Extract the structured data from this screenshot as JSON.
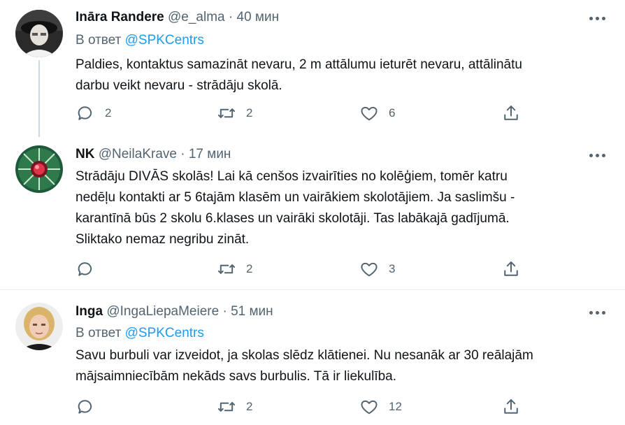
{
  "tweets": [
    {
      "name": "Ināra Randere",
      "handle": "@e_alma",
      "separator": "·",
      "time": "40 мин",
      "reply_prefix": "В ответ",
      "reply_mention": "@SPKCentrs",
      "text": "Paldies, kontaktus samazināt nevaru, 2 m attālumu ieturēt nevaru, attālinātu\ndarbu veikt nevaru - strādāju skolā.",
      "replies": "2",
      "retweets": "2",
      "likes": "6"
    },
    {
      "name": "NK",
      "handle": "@NeilaKrave",
      "separator": "·",
      "time": "17 мин",
      "text": "Strādāju DIVĀS skolās! Lai kā cenšos izvairīties no kolēģiem, tomēr katru\nnedēļu kontakti ar 5 6tajām klasēm un vairākiem skolotājiem. Ja saslimšu -\nkarantīnā būs 2 skolu 6.klases un vairāki skolotāji. Tas labākajā gadījumā.\nSliktako nemaz negribu zināt.",
      "replies": "",
      "retweets": "2",
      "likes": "3"
    },
    {
      "name": "Inga",
      "handle": "@IngaLiepaMeiere",
      "separator": "·",
      "time": "51 мин",
      "reply_prefix": "В ответ",
      "reply_mention": "@SPKCentrs",
      "text": "Savu burbuli var izveidot, ja skolas slēdz klātienei. Nu nesanāk ar 30 reālajām\nmājsaimniecībām nekāds savs burbulis. Tā ir liekulība.",
      "replies": "",
      "retweets": "2",
      "likes": "12"
    }
  ],
  "icons": {
    "reply": "reply-icon",
    "retweet": "retweet-icon",
    "like": "like-icon",
    "share": "share-icon",
    "more": "more-icon"
  },
  "colors": {
    "mention": "#1d9bf0",
    "secondary": "#536471",
    "text": "#0f1419",
    "divider": "#e6ecf0",
    "thread_line": "#cfd9de"
  }
}
